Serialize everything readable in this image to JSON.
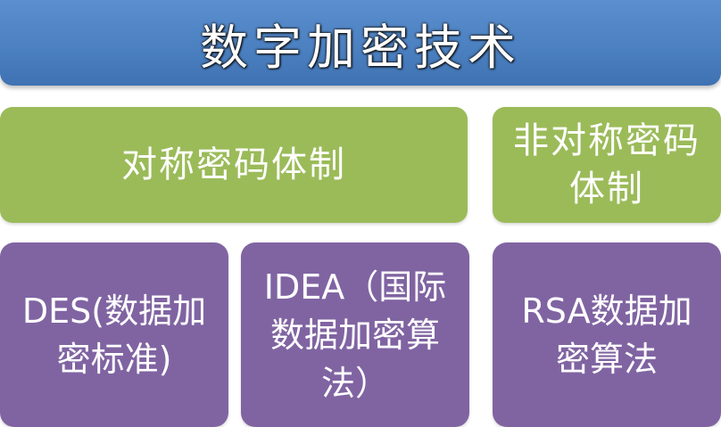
{
  "title": "数字加密技术",
  "categories": {
    "symmetric": "对称密码体制",
    "asymmetric": "非对称密码体制"
  },
  "algorithms": {
    "des": "DES(数据加密标准)",
    "idea": "IDEA（国际数据加密算法）",
    "rsa": "RSA数据加密算法"
  },
  "colors": {
    "title_bg": "#4a7fc0",
    "category_bg": "#9bbb59",
    "algorithm_bg": "#8064a2",
    "text": "#ffffff"
  }
}
